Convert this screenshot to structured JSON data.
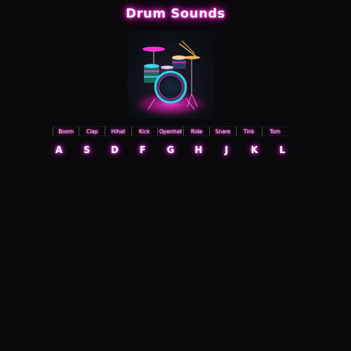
{
  "header": {
    "title": "Drum Sounds"
  },
  "artwork": {
    "icon": "drum-kit-image",
    "accent": "#ff2fd6",
    "secondary": "#3fd0e8"
  },
  "sounds": [
    {
      "label": "Boom",
      "key": "A"
    },
    {
      "label": "Clap",
      "key": "S"
    },
    {
      "label": "Hihat",
      "key": "D"
    },
    {
      "label": "Kick",
      "key": "F"
    },
    {
      "label": "Openhat",
      "key": "G"
    },
    {
      "label": "Ride",
      "key": "H"
    },
    {
      "label": "Snare",
      "key": "J"
    },
    {
      "label": "Tink",
      "key": "K"
    },
    {
      "label": "Tom",
      "key": "L"
    }
  ],
  "colors": {
    "background": "#0a090b",
    "neon_pink": "#ff2fd6",
    "neon_purple": "#c000ff"
  }
}
